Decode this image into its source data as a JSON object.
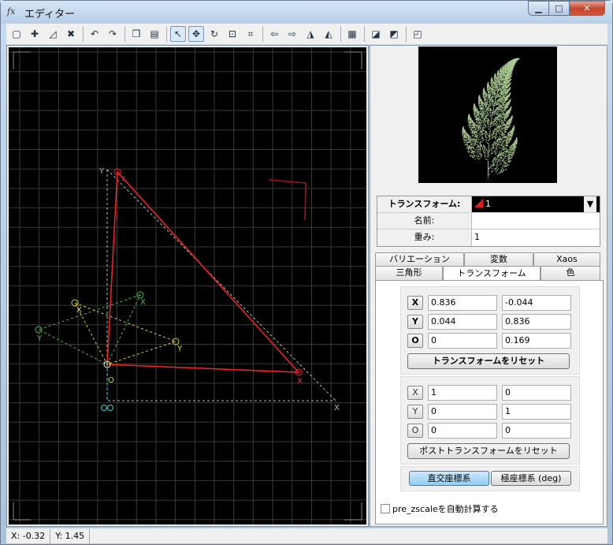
{
  "window": {
    "title": "エディター"
  },
  "toolbar": {
    "buttons": [
      {
        "name": "new-transform-icon",
        "glyph": "▢"
      },
      {
        "name": "add-transform-icon",
        "glyph": "✚"
      },
      {
        "name": "duplicate-transform-icon",
        "glyph": "◿"
      },
      {
        "name": "delete-transform-icon",
        "glyph": "✖"
      },
      {
        "sep": true
      },
      {
        "name": "undo-icon",
        "glyph": "↶"
      },
      {
        "name": "redo-icon",
        "glyph": "↷"
      },
      {
        "sep": true
      },
      {
        "name": "copy-icon",
        "glyph": "❐"
      },
      {
        "name": "paste-icon",
        "glyph": "▤"
      },
      {
        "sep": true
      },
      {
        "name": "select-mode-icon",
        "glyph": "↖",
        "active": true
      },
      {
        "name": "move-mode-icon",
        "glyph": "✥",
        "active": true
      },
      {
        "name": "rotate-mode-icon",
        "glyph": "↻"
      },
      {
        "name": "scale-mode-icon",
        "glyph": "⊡"
      },
      {
        "name": "fit-view-icon",
        "glyph": "⌗"
      },
      {
        "sep": true
      },
      {
        "name": "rotate-left-icon",
        "glyph": "⇦"
      },
      {
        "name": "rotate-right-icon",
        "glyph": "⇨"
      },
      {
        "name": "flip-horizontal-icon",
        "glyph": "◮"
      },
      {
        "name": "flip-vertical-icon",
        "glyph": "◭"
      },
      {
        "sep": true
      },
      {
        "name": "toggle-grid-icon",
        "glyph": "▦"
      },
      {
        "sep": true
      },
      {
        "name": "reset-all-icon",
        "glyph": "◪"
      },
      {
        "name": "reset-post-icon",
        "glyph": "◩"
      },
      {
        "sep": true
      },
      {
        "name": "settings-icon",
        "glyph": "◰"
      }
    ]
  },
  "editor": {
    "labels": {
      "x": "X",
      "y": "Y",
      "o": "O"
    },
    "colors": {
      "background": "#000000",
      "grid": "#3a3a3a",
      "main": "#ff2020",
      "yellow": "#d8d820",
      "green": "#40c040",
      "cyan": "#40d0d0",
      "reference": "#bbbbbb"
    }
  },
  "properties": {
    "transform_label": "トランスフォーム:",
    "transform_value": "1",
    "name_label": "名前:",
    "name_value": "",
    "weight_label": "重み:",
    "weight_value": "1"
  },
  "tabs": {
    "row1": [
      "バリエーション",
      "変数",
      "Xaos"
    ],
    "row2": [
      "三角形",
      "トランスフォーム",
      "色"
    ],
    "selected": "トランスフォーム"
  },
  "transform": {
    "rows": [
      {
        "label": "X",
        "a": "0.836",
        "b": "-0.044"
      },
      {
        "label": "Y",
        "a": "0.044",
        "b": "0.836"
      },
      {
        "label": "O",
        "a": "0",
        "b": "0.169"
      }
    ],
    "reset_label": "トランスフォームをリセット"
  },
  "post_transform": {
    "rows": [
      {
        "label": "X",
        "a": "1",
        "b": "0"
      },
      {
        "label": "Y",
        "a": "0",
        "b": "1"
      },
      {
        "label": "O",
        "a": "0",
        "b": "0"
      }
    ],
    "reset_label": "ポストトランスフォームをリセット"
  },
  "coords": {
    "rect_label": "直交座標系",
    "polar_label": "極座標系 (deg)"
  },
  "options": {
    "auto_zscale_label": "pre_zscaleを自動計算する"
  },
  "status": {
    "x": "X: -0.32",
    "y": "Y: 1.45"
  }
}
